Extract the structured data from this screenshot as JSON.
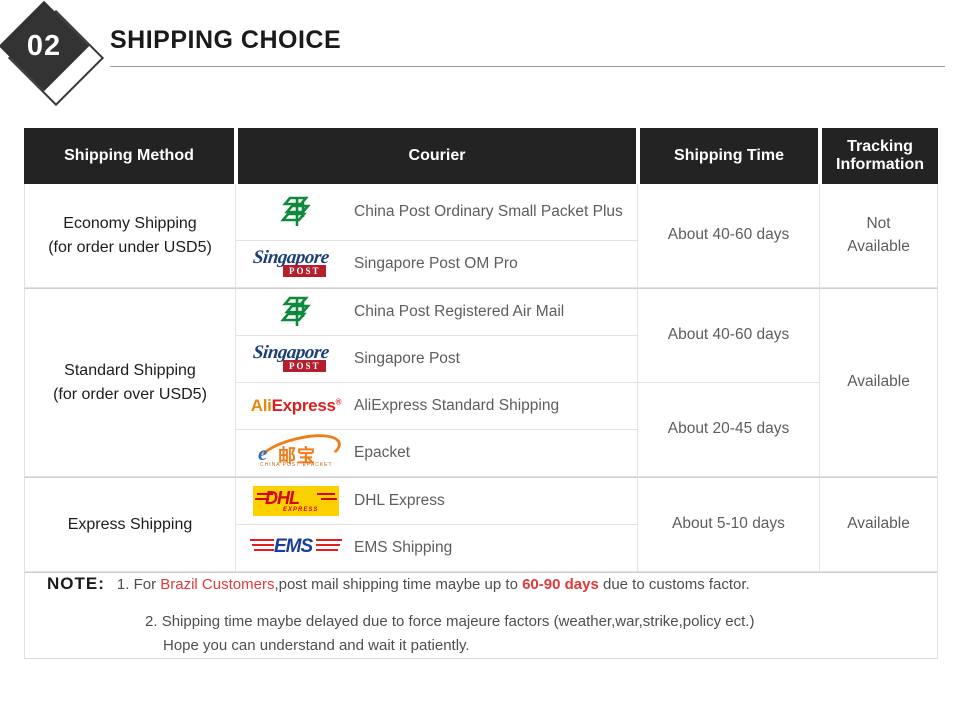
{
  "header": {
    "badge_number": "02",
    "title": "SHIPPING CHOICE"
  },
  "table": {
    "columns": [
      {
        "key": "method",
        "label": "Shipping Method"
      },
      {
        "key": "courier",
        "label": "Courier"
      },
      {
        "key": "time",
        "label": "Shipping Time"
      },
      {
        "key": "tracking",
        "label": "Tracking\nInformation"
      },
      {
        "key": "tracking_line1",
        "label": "Tracking"
      },
      {
        "key": "tracking_line2",
        "label": "Information"
      }
    ],
    "groups": [
      {
        "method_line1": "Economy Shipping",
        "method_line2": "(for order under USD5)",
        "couriers": [
          {
            "logo": "china-post-logo",
            "name": "China Post Ordinary Small Packet Plus"
          },
          {
            "logo": "singapore-post-logo",
            "name": "Singapore Post OM Pro"
          }
        ],
        "times": [
          {
            "label": "About 40-60 days",
            "rows": 2
          }
        ],
        "tracking": "Not Available",
        "tracking_line1": "Not",
        "tracking_line2": "Available"
      },
      {
        "method_line1": "Standard Shipping",
        "method_line2": "(for order over USD5)",
        "couriers": [
          {
            "logo": "china-post-logo",
            "name": "China Post Registered Air Mail"
          },
          {
            "logo": "singapore-post-logo",
            "name": "Singapore Post"
          },
          {
            "logo": "aliexpress-logo",
            "name": "AliExpress Standard Shipping"
          },
          {
            "logo": "epacket-logo",
            "name": "Epacket"
          }
        ],
        "times": [
          {
            "label": "About 40-60 days",
            "rows": 2
          },
          {
            "label": "About 20-45 days",
            "rows": 2
          }
        ],
        "tracking": "Available"
      },
      {
        "method_line1": "Express Shipping",
        "method_line2": "",
        "couriers": [
          {
            "logo": "dhl-logo",
            "name": "DHL Express"
          },
          {
            "logo": "ems-logo",
            "name": "EMS Shipping"
          }
        ],
        "times": [
          {
            "label": "About 5-10 days",
            "rows": 2
          }
        ],
        "tracking": "Available"
      }
    ]
  },
  "note": {
    "label": "NOTE:",
    "item1": {
      "number": "1.",
      "part1": "For ",
      "highlight1": "Brazil Customers",
      "part2": ",post mail shipping time maybe up to ",
      "highlight2": "60-90 days",
      "part3": " due to customs factor."
    },
    "item2": {
      "number": "2.",
      "line1": "Shipping time maybe delayed due to force majeure factors (weather,war,strike,policy ect.)",
      "line2": "Hope you can understand and wait it patiently."
    }
  },
  "logos": {
    "china_post": {
      "name": "China Post",
      "color": "#0f8a3c"
    },
    "singapore_post": {
      "script": "Singapore",
      "box": "POST",
      "script_color": "#1c3f7a",
      "box_color": "#b41f2e"
    },
    "aliexpress": {
      "part1": "Ali",
      "part2": "Express",
      "tm": "®",
      "color1": "#e8890c",
      "color2": "#d8211e"
    },
    "epacket": {
      "letter": "e",
      "chinese": "邮宝",
      "sub": "CHINA POST EPACKET",
      "blue": "#2f6fb5",
      "orange": "#ef7d1a"
    },
    "dhl": {
      "text": "DHL",
      "sub": "EXPRESS",
      "bg": "#fcd100",
      "fg": "#d40511"
    },
    "ems": {
      "text": "EMS",
      "color": "#1b3c9e",
      "bar_color": "#e02020"
    }
  },
  "colors": {
    "header_bg": "#232323",
    "header_fg": "#ffffff",
    "body_text": "#5d5d5d",
    "method_text": "#1c1c1c",
    "border": "#e2e2e2",
    "accent_red": "#e03a3a"
  }
}
